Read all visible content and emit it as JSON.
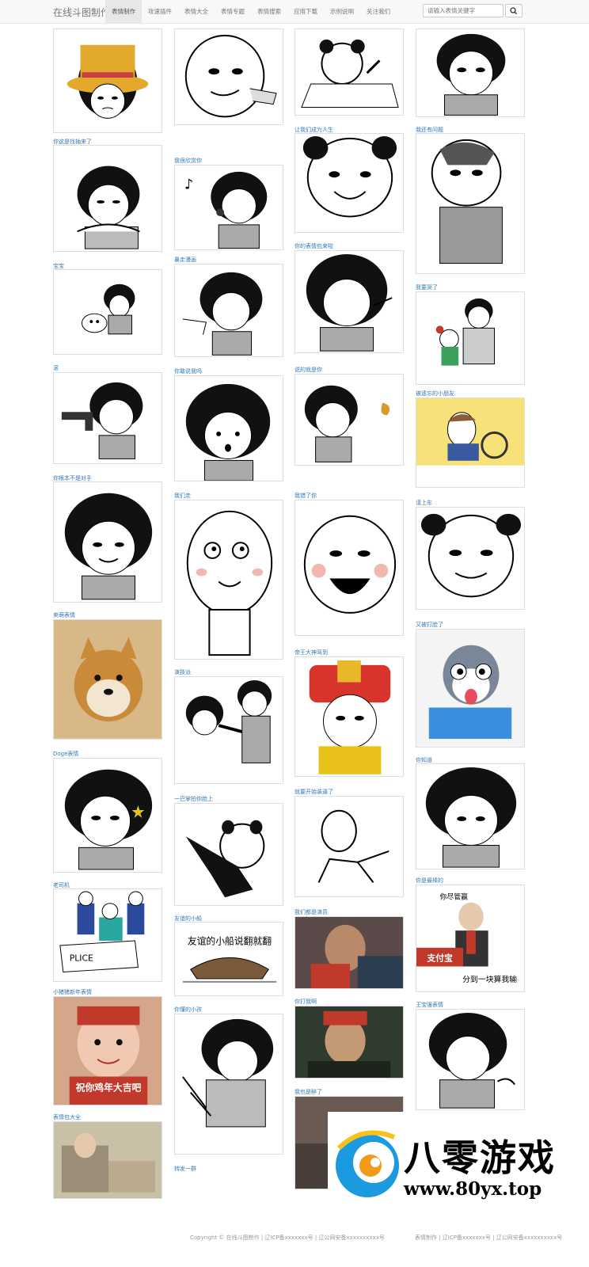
{
  "nav": {
    "brand": "在线斗图制作",
    "items": [
      "表情制作",
      "攻速插件",
      "表情大全",
      "表情专题",
      "表情搜索",
      "应用下载",
      "示例说明",
      "关注我们"
    ],
    "active_index": 0
  },
  "search": {
    "placeholder": "请输入表情关键字"
  },
  "cards": [
    {
      "caption": "",
      "card": "card-1"
    },
    {
      "caption": "",
      "card": "card-2"
    },
    {
      "caption": "",
      "card": "card-3"
    },
    {
      "caption": "",
      "card": "card-4"
    },
    {
      "caption": "你这是找抽来了",
      "card": "card-5"
    },
    {
      "caption": "我很欣赏你",
      "card": "card-6"
    },
    {
      "caption": "让我们成为人生",
      "card": "card-7"
    },
    {
      "caption": "我还有问题",
      "card": "card-8"
    },
    {
      "caption": "宝宝",
      "card": "card-9"
    },
    {
      "caption": "暴走漫画",
      "card": "card-10"
    },
    {
      "caption": "你的表情包来啦",
      "card": "card-11"
    },
    {
      "caption": "我要哭了",
      "card": "card-12"
    },
    {
      "caption": "滚",
      "card": "card-13"
    },
    {
      "caption": "你敢说我吗",
      "card": "card-14"
    },
    {
      "caption": "说的就是你",
      "card": "card-15"
    },
    {
      "caption": "被遗忘的小朋友",
      "card": "card-16"
    },
    {
      "caption": "你根本不是对手",
      "card": "card-17"
    },
    {
      "caption": "我们走",
      "card": "card-18"
    },
    {
      "caption": "我错了你",
      "card": "card-19"
    },
    {
      "caption": "请上车",
      "card": "card-20"
    },
    {
      "caption": "卖萌表情",
      "card": "card-21"
    },
    {
      "caption": "演技派",
      "card": "card-22"
    },
    {
      "caption": "帝王大神驾到",
      "card": "card-23"
    },
    {
      "caption": "又被打脸了",
      "card": "card-24"
    },
    {
      "caption": "Doge表情",
      "card": "card-25"
    },
    {
      "caption": "一巴掌拍你脸上",
      "card": "card-26"
    },
    {
      "caption": "就要开始装逼了",
      "card": "card-27"
    },
    {
      "caption": "你知道",
      "card": "card-28"
    },
    {
      "caption": "老司机",
      "card": "card-29"
    },
    {
      "caption": "友谊的小船",
      "card": "card-30"
    },
    {
      "caption": "我们都是演员",
      "card": "card-31"
    },
    {
      "caption": "你是最棒的",
      "card": "card-32"
    },
    {
      "caption": "小猪猪新年表情",
      "card": "card-33"
    },
    {
      "caption": "你懂的小孩",
      "card": "card-34"
    },
    {
      "caption": "你打我啊",
      "card": "card-35"
    },
    {
      "caption": "表情包大全",
      "card": "card-36"
    },
    {
      "caption": "我也是醉了",
      "card": "card-37"
    },
    {
      "caption": "",
      "card": "card-38"
    },
    {
      "caption": "王宝强表情",
      "card": "card-39"
    }
  ],
  "meme_texts": {
    "boat": "友谊的小船说翻就翻",
    "alipay_top": "你尽管赢",
    "alipay_brand": "支付宝",
    "alipay_bottom": "分到一块算我输",
    "newyear": "祝你鸡年大吉吧",
    "police": "PLICE"
  },
  "footer": {
    "copyright": "Copyright © 在线斗图制作 | 辽ICP备xxxxxxx号 | 辽公网安备xxxxxxxxxx号",
    "copyright_right": "表情制作 | 辽ICP备xxxxxxx号 | 辽公网安备xxxxxxxxxx号",
    "last_caption": "转发一群"
  },
  "watermark": {
    "title": "八零游戏",
    "url": "www.80yx.top"
  }
}
